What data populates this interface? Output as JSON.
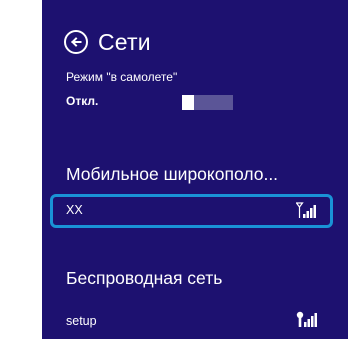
{
  "header": {
    "title": "Сети",
    "back_icon": "back-arrow-icon"
  },
  "airplane_mode": {
    "label": "Режим \"в самолете\"",
    "state": "Откл.",
    "on": false
  },
  "mobile_broadband": {
    "title": "Мобильное широкополо...",
    "networks": [
      {
        "name": "XX",
        "icon": "mobile-signal-icon",
        "selected": true
      }
    ]
  },
  "wifi": {
    "title": "Беспроводная сеть",
    "networks": [
      {
        "name": "setup",
        "icon": "wifi-signal-icon",
        "selected": false
      }
    ]
  },
  "colors": {
    "background": "#1d1170",
    "selection": "#1a93d6",
    "text": "#ffffff"
  }
}
